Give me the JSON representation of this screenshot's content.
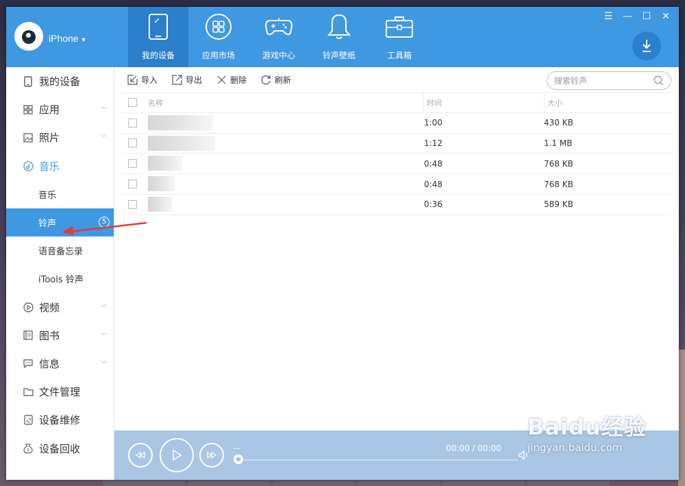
{
  "header": {
    "device_name": "iPhone",
    "nav": [
      {
        "label": "我的设备",
        "icon": "tablet-icon"
      },
      {
        "label": "应用市场",
        "icon": "apps-grid-icon"
      },
      {
        "label": "游戏中心",
        "icon": "gamepad-icon"
      },
      {
        "label": "铃声壁纸",
        "icon": "bell-icon"
      },
      {
        "label": "工具箱",
        "icon": "toolbox-icon"
      }
    ],
    "window_controls": [
      "menu",
      "minimize",
      "maximize",
      "close"
    ]
  },
  "sidebar": {
    "items": [
      {
        "label": "我的设备",
        "icon": "phone-icon"
      },
      {
        "label": "应用",
        "icon": "grid-icon"
      },
      {
        "label": "照片",
        "icon": "image-icon"
      },
      {
        "label": "音乐",
        "icon": "music-icon"
      },
      {
        "label": "音乐"
      },
      {
        "label": "铃声",
        "count": "5"
      },
      {
        "label": "语音备忘录"
      },
      {
        "label": "iTools 铃声"
      },
      {
        "label": "视频",
        "icon": "play-icon"
      },
      {
        "label": "图书",
        "icon": "book-icon"
      },
      {
        "label": "信息",
        "icon": "message-icon"
      },
      {
        "label": "文件管理",
        "icon": "folder-icon"
      },
      {
        "label": "设备维修",
        "icon": "repair-icon"
      },
      {
        "label": "设备回收",
        "icon": "recycle-icon"
      }
    ]
  },
  "toolbar": {
    "import": "导入",
    "export": "导出",
    "delete": "删除",
    "refresh": "刷新",
    "search_placeholder": "搜索铃声"
  },
  "table": {
    "headers": {
      "name": "名称",
      "time": "时间",
      "size": "大小"
    },
    "rows": [
      {
        "name": "",
        "time": "1:00",
        "size": "430 KB"
      },
      {
        "name": "",
        "time": "1:12",
        "size": "1.1 MB"
      },
      {
        "name": "",
        "time": "0:48",
        "size": "768 KB"
      },
      {
        "name": "",
        "time": "0:48",
        "size": "768 KB"
      },
      {
        "name": "",
        "time": "0:36",
        "size": "589 KB"
      }
    ]
  },
  "player": {
    "track_title": "--",
    "time": "00:00 / 00:00",
    "progress": 0
  },
  "watermark": {
    "brand": "Baidu经验",
    "url": "jingyan.baidu.com"
  },
  "colors": {
    "accent": "#3f98e2",
    "accent_dark": "#2b7fcb",
    "player_bg": "#a9c6e4",
    "arrow": "#e8392f"
  }
}
